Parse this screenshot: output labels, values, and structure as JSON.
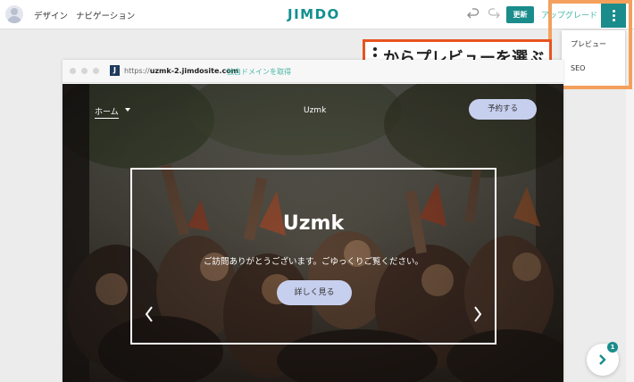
{
  "header": {
    "nav_design": "デザイン",
    "nav_navigation": "ナビゲーション",
    "logo": "JIMDO",
    "update_label": "更新",
    "upgrade_label": "アップグレード"
  },
  "menu": {
    "items": [
      {
        "label": "プレビュー"
      },
      {
        "label": "SEO"
      }
    ]
  },
  "callout": {
    "text": "からプレビューを選ぶ"
  },
  "browser": {
    "favicon_letter": "J",
    "url_prefix": "https://",
    "url_host": "uzmk-2.jimdosite.com",
    "custom_domain": "独自ドメインを取得"
  },
  "site": {
    "nav_home": "ホーム",
    "name": "Uzmk",
    "book_label": "予約する",
    "hero_title": "Uzmk",
    "hero_subtitle": "ご訪問ありがとうございます。ごゆっくりご覧ください。",
    "more_label": "詳しく見る"
  },
  "chat": {
    "badge_count": "1"
  },
  "colors": {
    "brand_teal": "#1a8c8c",
    "accent_green": "#44b7a4",
    "callout_border": "#e8531f",
    "highlight_border": "#f4a05c",
    "button_lavender": "#c7cfee"
  }
}
